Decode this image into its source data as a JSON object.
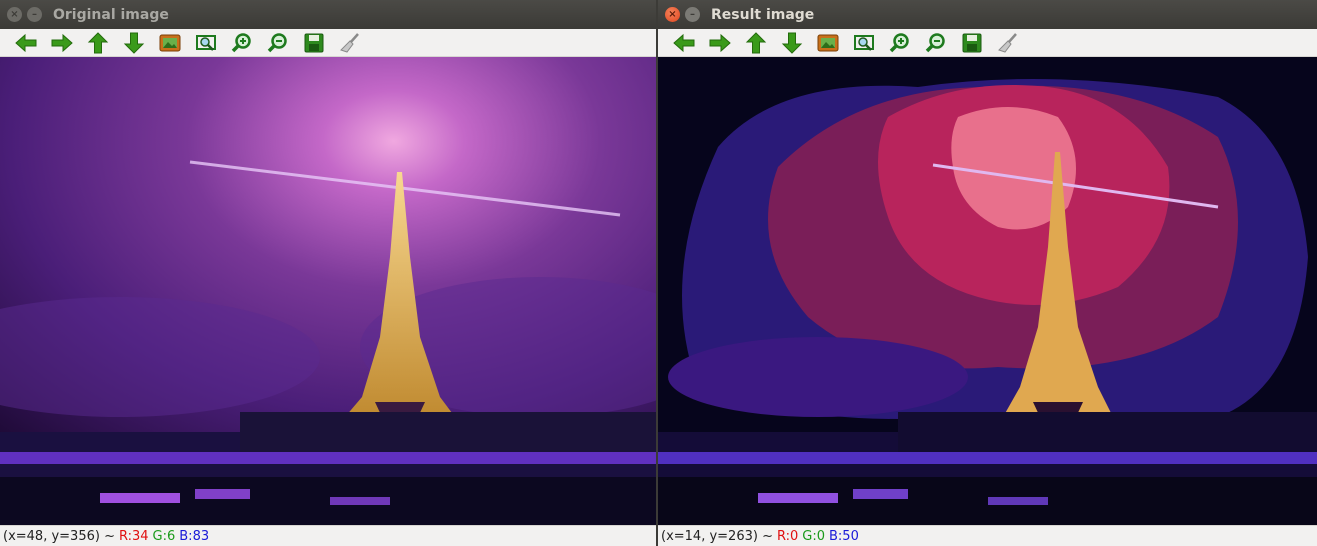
{
  "windows": [
    {
      "title": "Original image",
      "status": {
        "coords": "(x=48, y=356) ~",
        "r": "R:34",
        "g": "G:6",
        "b": "B:83"
      }
    },
    {
      "title": "Result image",
      "status": {
        "coords": "(x=14, y=263) ~",
        "r": "R:0",
        "g": "G:0",
        "b": "B:50"
      }
    }
  ],
  "toolbar_icons": [
    "arrow-left-icon",
    "arrow-right-icon",
    "arrow-up-icon",
    "arrow-down-icon",
    "image-icon",
    "zoom-fit-icon",
    "zoom-in-icon",
    "zoom-out-icon",
    "save-icon",
    "clear-brush-icon"
  ],
  "colors": {
    "titlebar": "#3c3b37",
    "toolbar": "#f2f1f0",
    "icon_green": "#3a9a1a",
    "close_active": "#e0461f"
  }
}
